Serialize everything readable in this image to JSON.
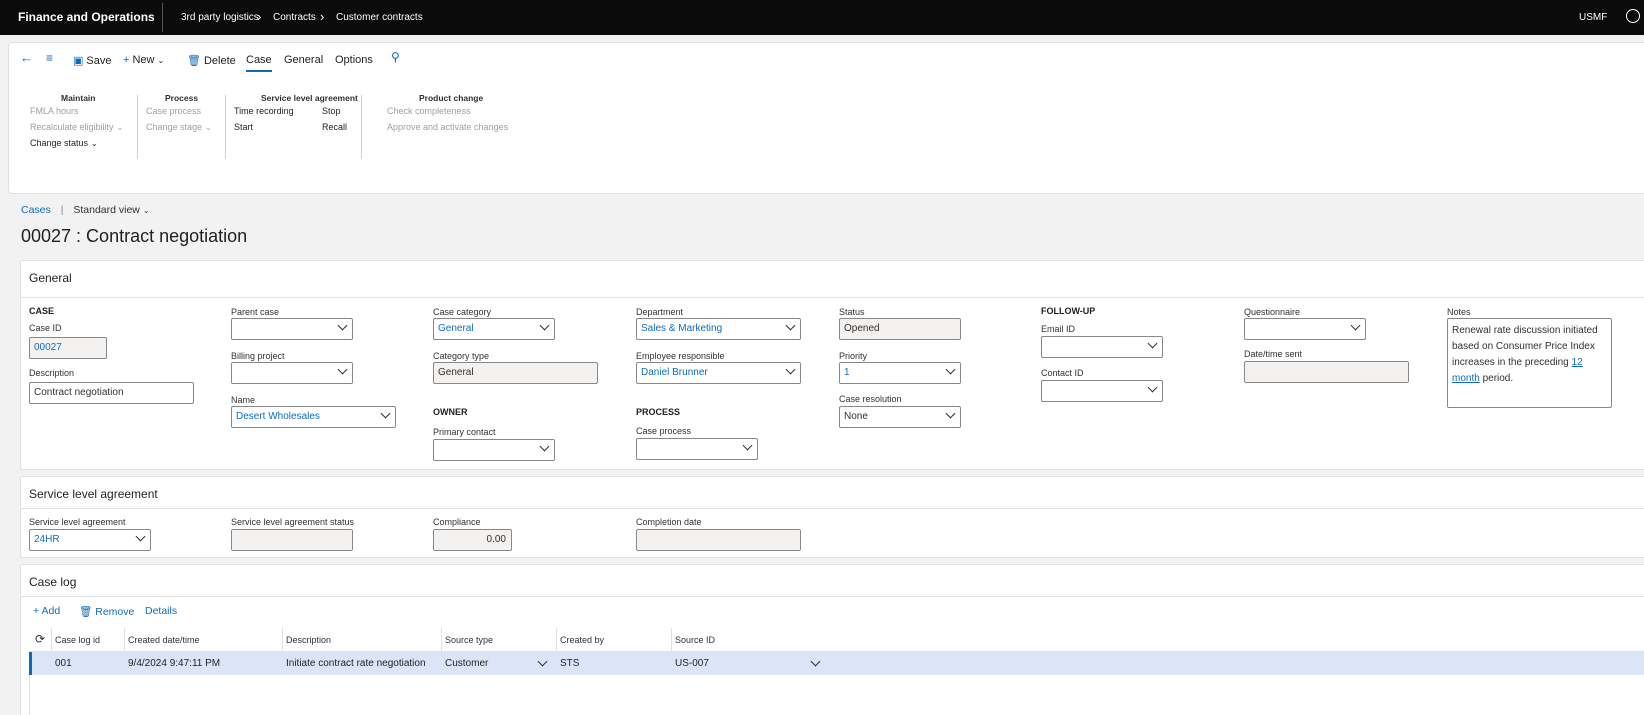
{
  "topbar": {
    "app_name": "Finance and Operations",
    "breadcrumbs": [
      "3rd party logistics",
      "Contracts",
      "Customer contracts"
    ],
    "company": "USMF"
  },
  "toolbar": {
    "save": "Save",
    "new": "New",
    "delete": "Delete",
    "tabs": [
      "Case",
      "General",
      "Options"
    ]
  },
  "ribbon": {
    "maintain": {
      "title": "Maintain",
      "items": [
        "FMLA hours",
        "Recalculate eligibility",
        "Change status"
      ]
    },
    "process": {
      "title": "Process",
      "items": [
        "Case process",
        "Change stage"
      ]
    },
    "sla": {
      "title": "Service level agreement",
      "items": [
        "Time recording",
        "Start",
        "Stop",
        "Recall"
      ]
    },
    "product": {
      "title": "Product change",
      "items": [
        "Check completeness",
        "Approve and activate changes"
      ]
    }
  },
  "nav": {
    "link": "Cases",
    "view": "Standard view"
  },
  "page_title": "00027 : Contract negotiation",
  "general": {
    "header": "General",
    "case_section": "CASE",
    "case_id_label": "Case ID",
    "case_id": "00027",
    "description_label": "Description",
    "description": "Contract negotiation",
    "parent_case_label": "Parent case",
    "parent_case": "",
    "billing_project_label": "Billing project",
    "billing_project": "",
    "name_label": "Name",
    "name": "Desert Wholesales",
    "case_category_label": "Case category",
    "case_category": "General",
    "category_type_label": "Category type",
    "category_type": "General",
    "owner_section": "OWNER",
    "primary_contact_label": "Primary contact",
    "primary_contact": "",
    "department_label": "Department",
    "department": "Sales & Marketing",
    "employee_label": "Employee responsible",
    "employee": "Daniel Brunner",
    "process_section": "PROCESS",
    "case_process_label": "Case process",
    "case_process": "",
    "status_label": "Status",
    "status": "Opened",
    "priority_label": "Priority",
    "priority": "1",
    "resolution_label": "Case resolution",
    "resolution": "None",
    "followup_section": "FOLLOW-UP",
    "email_label": "Email ID",
    "email": "",
    "contact_label": "Contact ID",
    "contact": "",
    "questionnaire_label": "Questionnaire",
    "questionnaire": "",
    "datetime_label": "Date/time sent",
    "datetime": "",
    "notes_label": "Notes",
    "notes_text": "Renewal rate discussion initiated based on Consumer Price Index increases in the preceding",
    "notes_link": "12 month",
    "notes_end": " period."
  },
  "sla": {
    "header": "Service level agreement",
    "sla_label": "Service level agreement",
    "sla": "24HR",
    "status_label": "Service level agreement status",
    "status": "",
    "compliance_label": "Compliance",
    "compliance": "0.00",
    "completion_label": "Completion date",
    "completion": ""
  },
  "caselog": {
    "header": "Case log",
    "add": "Add",
    "remove": "Remove",
    "details": "Details",
    "columns": [
      "Case log id",
      "Created date/time",
      "Description",
      "Source type",
      "Created by",
      "Source ID"
    ],
    "rows": [
      {
        "id": "001",
        "created": "9/4/2024 9:47:11 PM",
        "description": "Initiate contract rate negotiation",
        "source_type": "Customer",
        "created_by": "STS",
        "source_id": "US-007"
      }
    ]
  }
}
